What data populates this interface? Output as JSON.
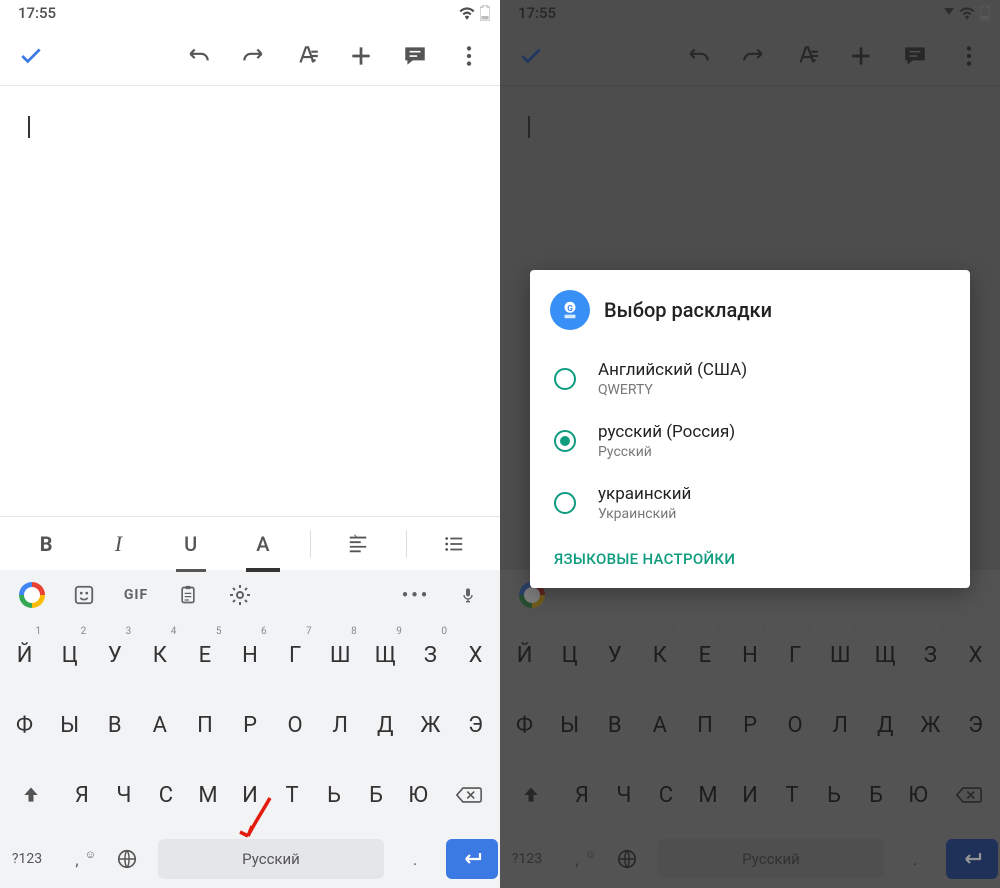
{
  "status": {
    "time": "17:55"
  },
  "toolbar": {
    "check": "✓",
    "undo": "↶",
    "redo": "↷",
    "A_format": "A",
    "plus": "+",
    "comment": "💬",
    "more": "⋮"
  },
  "format": {
    "bold": "B",
    "italic": "I",
    "underline": "U",
    "color": "A",
    "align": "≡",
    "list": "≡"
  },
  "suggest": {
    "gif": "GIF",
    "more": "•••"
  },
  "keyboard": {
    "row1": [
      {
        "k": "Й",
        "n": "1"
      },
      {
        "k": "Ц",
        "n": "2"
      },
      {
        "k": "У",
        "n": "3"
      },
      {
        "k": "К",
        "n": "4"
      },
      {
        "k": "Е",
        "n": "5"
      },
      {
        "k": "Н",
        "n": "6"
      },
      {
        "k": "Г",
        "n": "7"
      },
      {
        "k": "Ш",
        "n": "8"
      },
      {
        "k": "Щ",
        "n": "9"
      },
      {
        "k": "З",
        "n": "0"
      },
      {
        "k": "Х"
      }
    ],
    "row2": [
      {
        "k": "Ф"
      },
      {
        "k": "Ы"
      },
      {
        "k": "В"
      },
      {
        "k": "А"
      },
      {
        "k": "П"
      },
      {
        "k": "Р"
      },
      {
        "k": "О"
      },
      {
        "k": "Л"
      },
      {
        "k": "Д"
      },
      {
        "k": "Ж"
      },
      {
        "k": "Э"
      }
    ],
    "row3": [
      {
        "k": "Я"
      },
      {
        "k": "Ч"
      },
      {
        "k": "С"
      },
      {
        "k": "М"
      },
      {
        "k": "И"
      },
      {
        "k": "Т"
      },
      {
        "k": "Ь"
      },
      {
        "k": "Б"
      },
      {
        "k": "Ю"
      }
    ],
    "bottom": {
      "sym": "?123",
      "comma": ",",
      "space": "Русский",
      "dot": "."
    }
  },
  "dialog": {
    "title": "Выбор раскладки",
    "options": [
      {
        "primary": "Английский (США)",
        "secondary": "QWERTY",
        "checked": false
      },
      {
        "primary": "русский (Россия)",
        "secondary": "Русский",
        "checked": true
      },
      {
        "primary": "украинский",
        "secondary": "Украинский",
        "checked": false
      }
    ],
    "link": "ЯЗЫКОВЫЕ НАСТРОЙКИ"
  }
}
